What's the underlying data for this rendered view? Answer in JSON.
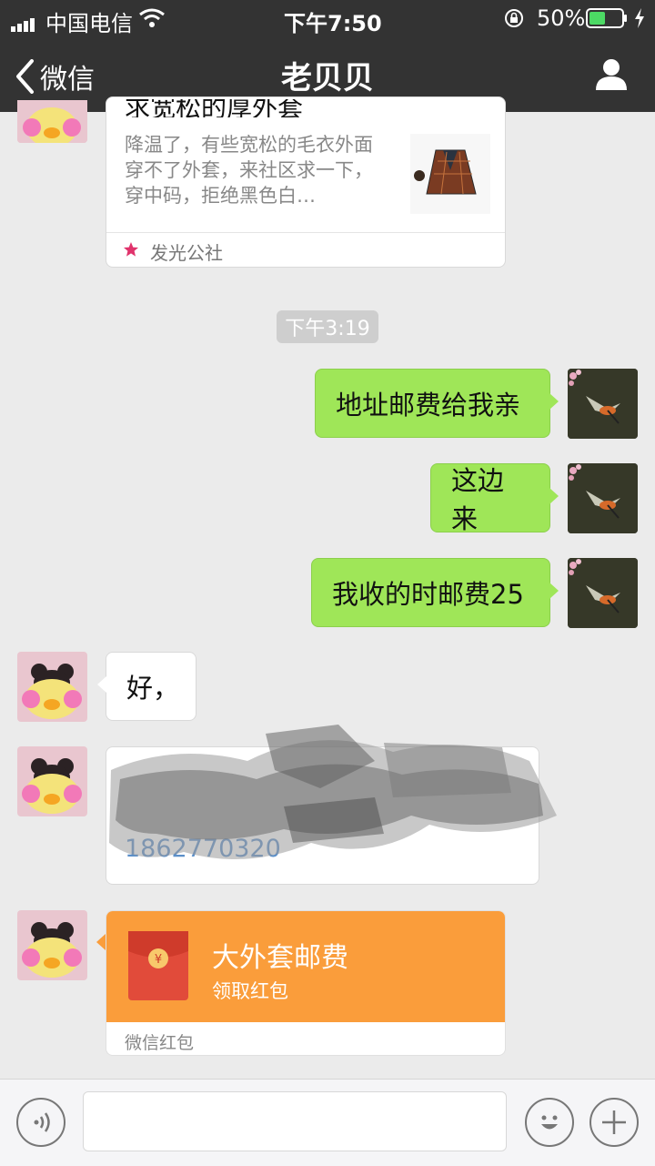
{
  "status_bar": {
    "carrier": "中国电信",
    "time": "下午7:50",
    "battery": "50%",
    "battery_level": 0.5
  },
  "nav": {
    "back_label": "微信",
    "title": "老贝贝"
  },
  "article_card": {
    "title_partial": "求宽松的厚外套",
    "description": "降温了，有些宽松的毛衣外面穿不了外套，来社区求一下，穿中码，拒绝黑色白…",
    "source": "发光公社"
  },
  "timestamp": "下午3:19",
  "messages": [
    {
      "side": "right",
      "text": "地址邮费给我亲"
    },
    {
      "side": "right",
      "text": "这边来"
    },
    {
      "side": "right",
      "text": "我收的时邮费25"
    },
    {
      "side": "left",
      "text": "好，"
    }
  ],
  "contact_card": {
    "phone_partial": "1862770320"
  },
  "red_packet": {
    "title": "大外套邮费",
    "subtitle": "领取红包",
    "footer": "微信红包",
    "symbol": "¥"
  },
  "colors": {
    "nav_bg": "#333333",
    "bubble_green": "#9fe658",
    "red_packet_orange": "#fa9d3b"
  }
}
